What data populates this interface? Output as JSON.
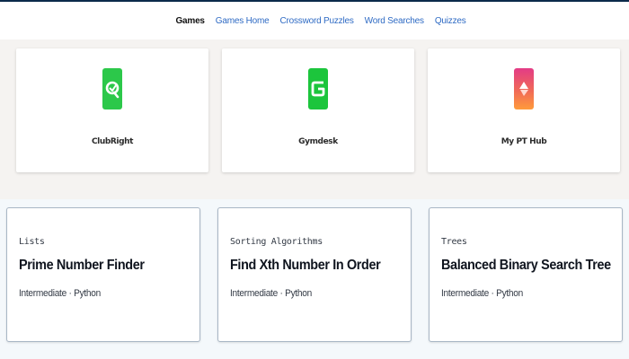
{
  "nav": {
    "items": [
      {
        "label": "Games",
        "active": true
      },
      {
        "label": "Games Home",
        "active": false
      },
      {
        "label": "Crossword Puzzles",
        "active": false
      },
      {
        "label": "Word Searches",
        "active": false
      },
      {
        "label": "Quizzes",
        "active": false
      }
    ]
  },
  "apps": [
    {
      "name": "ClubRight",
      "icon": "clubright-logo-icon",
      "color": "#2cc84a"
    },
    {
      "name": "Gymdesk",
      "icon": "gymdesk-logo-icon",
      "color": "#1cc53c"
    },
    {
      "name": "My PT Hub",
      "icon": "mypthub-logo-icon",
      "color": "#e33b86"
    }
  ],
  "courses": [
    {
      "category": "Lists",
      "title": "Prime Number Finder",
      "meta": "Intermediate · Python"
    },
    {
      "category": "Sorting Algorithms",
      "title": "Find Xth Number In Order",
      "meta": "Intermediate · Python"
    },
    {
      "category": "Trees",
      "title": "Balanced Binary Search Tree",
      "meta": "Intermediate · Python"
    }
  ],
  "colors": {
    "nav_link": "#2f6bc4",
    "nav_active": "#111111",
    "card_border": "#a9b7c6"
  }
}
